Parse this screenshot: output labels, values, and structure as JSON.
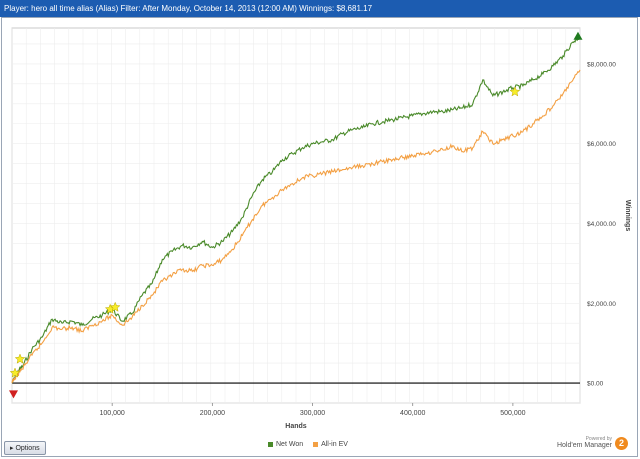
{
  "header": {
    "title": "Player: hero all time alias (Alias)  Filter: After Monday, October 14, 2013 (12:00 AM)  Winnings: $8,681.17"
  },
  "footer": {
    "options_label": "Options",
    "powered_by": "Powered by",
    "brand": "Hold'em Manager",
    "badge": "2"
  },
  "colors": {
    "net_won": "#4a8a2a",
    "all_in_ev": "#f3a044",
    "zero_line": "#000000",
    "title_bar": "#1c5cb1"
  },
  "chart_data": {
    "type": "line",
    "xlabel": "Hands",
    "ylabel": "Winnings",
    "xlim": [
      0,
      567000
    ],
    "ylim": [
      -500,
      8900
    ],
    "x_ticks": [
      100000,
      200000,
      300000,
      400000,
      500000
    ],
    "x_tick_labels": [
      "100,000",
      "200,000",
      "300,000",
      "400,000",
      "500,000"
    ],
    "y_ticks": [
      0,
      2000,
      4000,
      6000,
      8000
    ],
    "y_tick_labels": [
      "$0.00",
      "$2,000.00",
      "$4,000.00",
      "$6,000.00",
      "$8,000.00"
    ],
    "grid": true,
    "legend": "bottom-center",
    "series": [
      {
        "name": "Net Won",
        "x": [
          0,
          5000,
          10000,
          20000,
          30000,
          40000,
          50000,
          60000,
          70000,
          80000,
          90000,
          100000,
          110000,
          120000,
          130000,
          140000,
          150000,
          160000,
          170000,
          180000,
          190000,
          200000,
          210000,
          220000,
          230000,
          240000,
          250000,
          260000,
          270000,
          280000,
          290000,
          300000,
          310000,
          320000,
          330000,
          340000,
          350000,
          360000,
          370000,
          380000,
          390000,
          400000,
          410000,
          420000,
          430000,
          440000,
          450000,
          460000,
          470000,
          480000,
          490000,
          500000,
          510000,
          520000,
          530000,
          540000,
          550000,
          560000,
          567000
        ],
        "y": [
          0,
          250,
          400,
          850,
          1150,
          1600,
          1500,
          1550,
          1450,
          1600,
          1700,
          1850,
          1550,
          1750,
          2200,
          2500,
          3100,
          3300,
          3450,
          3400,
          3550,
          3400,
          3550,
          3800,
          4150,
          4700,
          5100,
          5300,
          5600,
          5750,
          5900,
          6000,
          6050,
          6100,
          6250,
          6350,
          6400,
          6500,
          6550,
          6600,
          6650,
          6700,
          6750,
          6800,
          6800,
          6850,
          6900,
          7000,
          7600,
          7200,
          7300,
          7400,
          7450,
          7600,
          7750,
          7950,
          8200,
          8550,
          8681
        ]
      },
      {
        "name": "All-in EV",
        "x": [
          0,
          5000,
          10000,
          20000,
          30000,
          40000,
          50000,
          60000,
          70000,
          80000,
          90000,
          100000,
          110000,
          120000,
          130000,
          140000,
          150000,
          160000,
          170000,
          180000,
          190000,
          200000,
          210000,
          220000,
          230000,
          240000,
          250000,
          260000,
          270000,
          280000,
          290000,
          300000,
          310000,
          320000,
          330000,
          340000,
          350000,
          360000,
          370000,
          380000,
          390000,
          400000,
          410000,
          420000,
          430000,
          440000,
          450000,
          460000,
          470000,
          480000,
          490000,
          500000,
          510000,
          520000,
          530000,
          540000,
          550000,
          560000,
          567000
        ],
        "y": [
          0,
          200,
          350,
          700,
          1000,
          1400,
          1350,
          1400,
          1300,
          1450,
          1550,
          1700,
          1450,
          1650,
          1950,
          2200,
          2550,
          2700,
          2850,
          2800,
          2950,
          2950,
          3100,
          3350,
          3700,
          4100,
          4450,
          4650,
          4850,
          5000,
          5150,
          5200,
          5250,
          5300,
          5350,
          5400,
          5450,
          5500,
          5550,
          5600,
          5650,
          5700,
          5750,
          5800,
          5850,
          5950,
          5800,
          5900,
          6300,
          6000,
          6100,
          6200,
          6300,
          6500,
          6700,
          6950,
          7250,
          7600,
          7850
        ]
      }
    ],
    "markers": [
      {
        "series": "Net Won",
        "x": 3000,
        "y": 250,
        "shape": "star",
        "color": "#f7ec2a"
      },
      {
        "series": "All-in EV",
        "x": 8000,
        "y": 600,
        "shape": "star",
        "color": "#f7ec2a"
      },
      {
        "series": "Net Won",
        "x": 98000,
        "y": 1850,
        "shape": "star",
        "color": "#f7ec2a"
      },
      {
        "series": "All-in EV",
        "x": 103000,
        "y": 1900,
        "shape": "star",
        "color": "#f7ec2a"
      },
      {
        "series": "Net Won",
        "x": 502000,
        "y": 7300,
        "shape": "star",
        "color": "#f7ec2a"
      },
      {
        "series": "Net Won",
        "x": 565000,
        "y": 8681,
        "shape": "triangle-up",
        "color": "#1f7a1f"
      },
      {
        "series": "Net Won",
        "x": 1500,
        "y": -260,
        "shape": "triangle-down",
        "color": "#d02020"
      }
    ]
  }
}
